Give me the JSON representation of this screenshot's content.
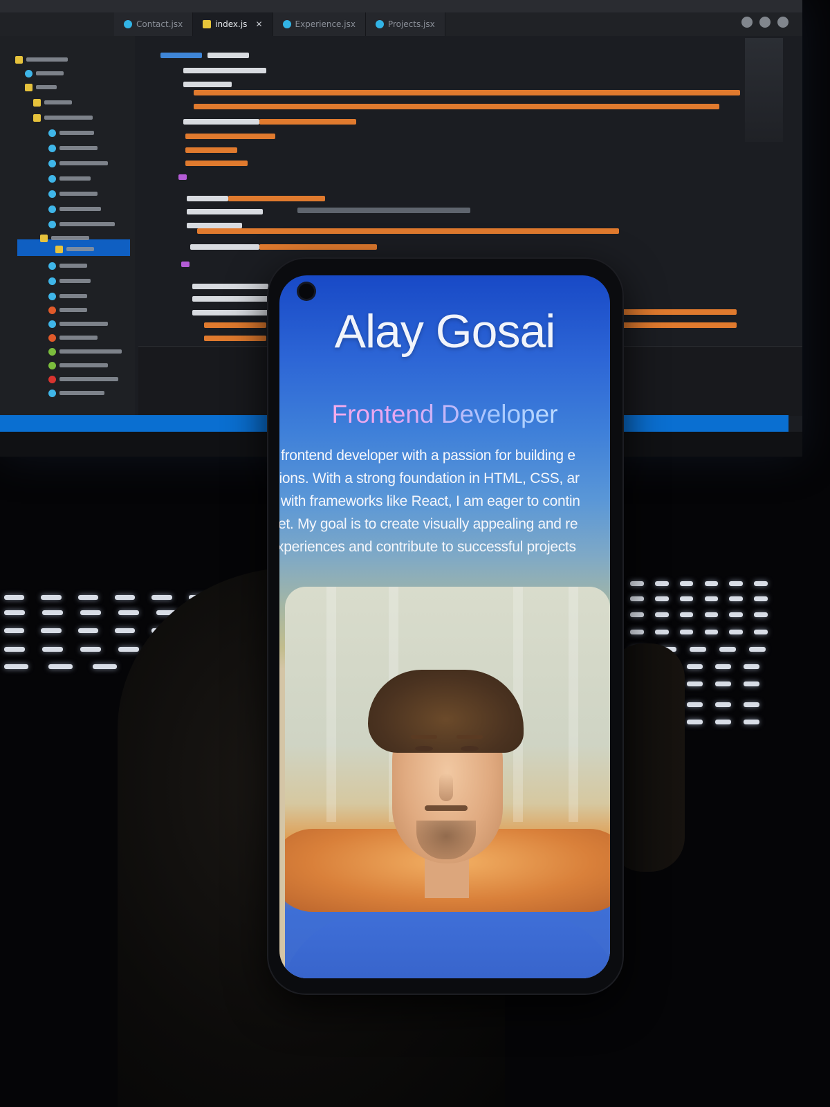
{
  "phone_screen": {
    "name": "Alay Gosai",
    "role": "Frontend Developer",
    "bio_lines": [
      "frontend developer with a passion for building e",
      "tions. With a strong foundation in HTML, CSS, ar",
      "with frameworks like React, I am eager to contin",
      "et. My goal is to create visually appealing and re",
      "xperiences and contribute to successful projects"
    ]
  },
  "editor": {
    "tabs": [
      "Contact.jsx",
      "index.js",
      "Experience.jsx",
      "Projects.jsx"
    ],
    "active_tab": "index.js"
  },
  "colors": {
    "screen_blue": "#1849c6",
    "role_pink": "#ffb2e8",
    "role_blue": "#a4c7ff",
    "code_orange": "#e07a2e",
    "status_blue": "#0a6fd1"
  }
}
